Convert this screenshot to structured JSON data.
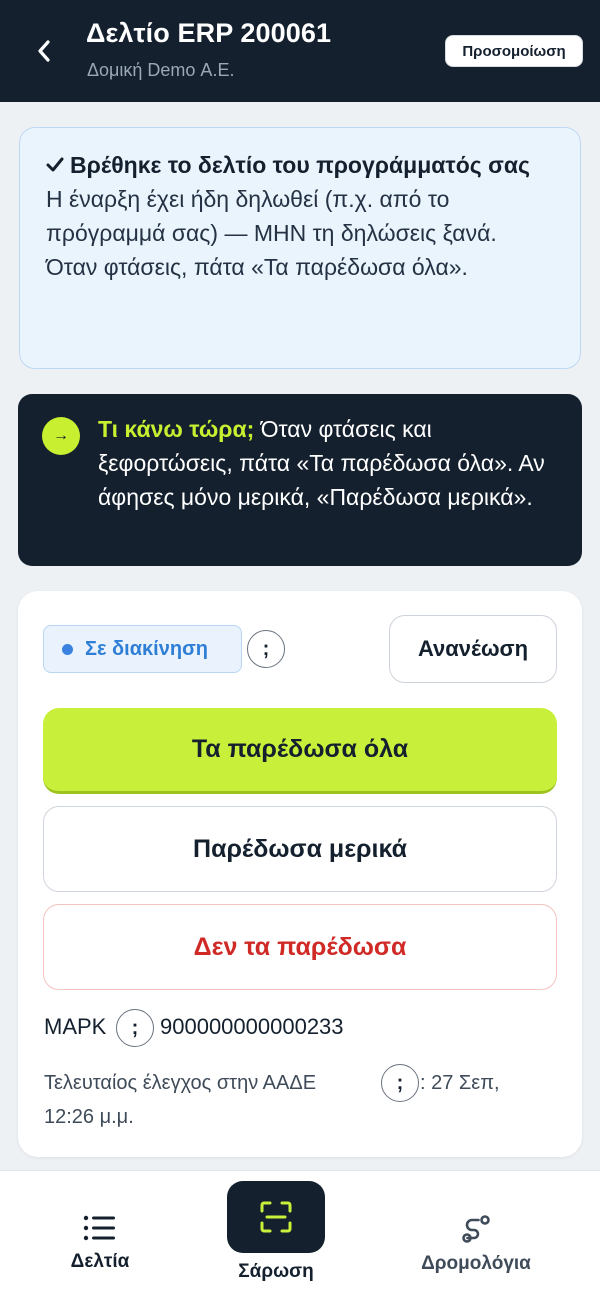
{
  "header": {
    "title": "Δελτίο ERP 200061",
    "subtitle": "Δομική Demo Α.Ε.",
    "badge": "Προσομοίωση"
  },
  "notice": {
    "title": "Βρέθηκε το δελτίο του προγράμματός σας",
    "body": "Η έναρξη έχει ήδη δηλωθεί (π.χ. από το πρόγραμμά σας) — ΜΗΝ τη δηλώσεις ξανά. Όταν φτάσεις, πάτα «Τα παρέδωσα όλα»."
  },
  "hint": {
    "icon_glyph": "→",
    "lead": "Τι κάνω τώρα;",
    "text": " Όταν φτάσεις και ξεφορτώσεις, πάτα «Τα παρέδωσα όλα». Αν άφησες μόνο μερικά, «Παρέδωσα μερικά»."
  },
  "card": {
    "status": "Σε διακίνηση",
    "help_glyph": ";",
    "refresh": "Ανανέωση",
    "primary": "Τα παρέδωσα όλα",
    "secondary": "Παρέδωσα μερικά",
    "danger": "Δεν τα παρέδωσα",
    "mark_label": "ΜΑΡΚ",
    "mark_value": "900000000000233",
    "check_label": "Τελευταίος έλεγχος στην ΑΑΔΕ",
    "check_value": ": 27 Σεπ,",
    "check_time": "12:26 μ.μ."
  },
  "nav": {
    "items": [
      {
        "label": "Δελτία",
        "icon": "list-icon"
      },
      {
        "label": "Σάρωση",
        "icon": "scan-icon"
      },
      {
        "label": "Δρομολόγια",
        "icon": "route-icon"
      }
    ]
  },
  "colors": {
    "navy": "#14202e",
    "lime": "#c8f03a",
    "blue": "#2f7fd6",
    "red": "#d02a26"
  }
}
